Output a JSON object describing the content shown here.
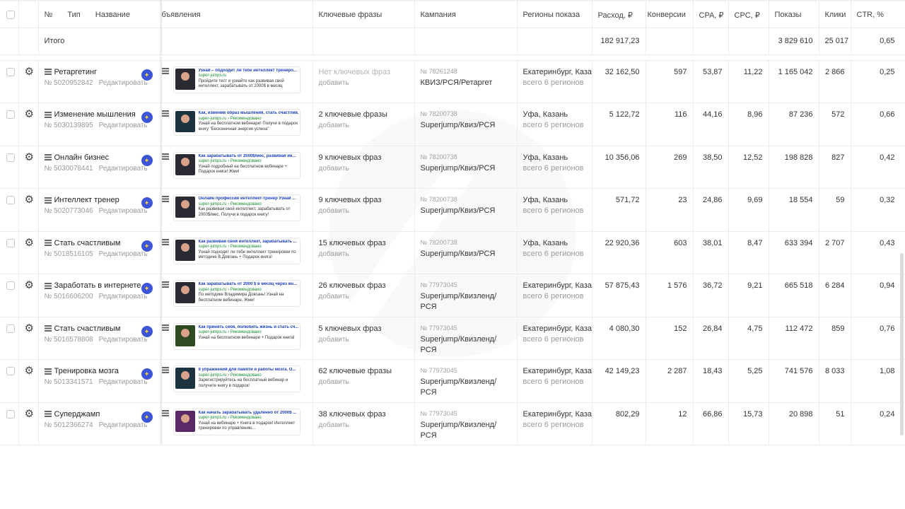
{
  "header": {
    "num": "№",
    "type": "Тип",
    "name": "Название",
    "ads": "бъявления",
    "keywords": "Ключевые фразы",
    "campaign": "Кампания",
    "regions": "Регионы показа",
    "spend": "Расход, ₽",
    "conversions": "Конверсии",
    "cpa": "CPA, ₽",
    "cpc": "CPC, ₽",
    "impressions": "Показы",
    "clicks": "Клики",
    "ctr": "CTR, %"
  },
  "total": {
    "label": "Итого",
    "spend": "182 917,23",
    "impressions": "3 829 610",
    "clicks": "25 017",
    "ctr": "0,65"
  },
  "icons": {
    "settings": "gear-icon",
    "badge": "autotargeting-badge-icon",
    "type": "list-type-icon"
  },
  "rows": [
    {
      "name": "Ретаргетинг",
      "id": "№ 5020952842",
      "edit": "Редактировать",
      "ad_title": "Узнай – подходит ли тебе интеллект трениро...",
      "ad_url": "super-jumps.ru",
      "ad_desc": "Пройдите тест и узнайте как развивая свой интеллект, зарабатывать от 2000$ в месяц",
      "kw": "Нет ключевых фраз",
      "kw_add": "добавить",
      "c_num": "№ 78261248",
      "c_name": "КВИЗ/РСЯ/Ретаргет",
      "region": "Екатеринбург, Каза",
      "region_sub": "всего 6 регионов",
      "spend": "32 162,50",
      "conv": "597",
      "cpa": "53,87",
      "cpc": "11,22",
      "impr": "1 165 042",
      "clicks": "2 866",
      "ctr": "0,25"
    },
    {
      "name": "Изменение мышления",
      "id": "№ 5030139895",
      "edit": "Редактировать",
      "ad_title": "Как, изменив образ мышления, стать счастлив...",
      "ad_url": "super-jumps.ru › Рекомендовано",
      "ad_desc": "Узнай на бесплатном вебинаре! Получи в подарок книгу \"Бесконечная энергия успеха\"",
      "kw": "2 ключевые фразы",
      "kw_add": "добавить",
      "c_num": "№ 78200738",
      "c_name": "Superjump/Квиз/РСЯ",
      "region": "Уфа, Казань",
      "region_sub": "всего 6 регионов",
      "spend": "5 122,72",
      "conv": "116",
      "cpa": "44,16",
      "cpc": "8,96",
      "impr": "87 236",
      "clicks": "572",
      "ctr": "0,66"
    },
    {
      "name": "Онлайн бизнес",
      "id": "№ 5030078441",
      "edit": "Редактировать",
      "ad_title": "Как зарабатывать от 2000$/мес, развивая ин...",
      "ad_url": "super-jumps.ru › Рекомендовано",
      "ad_desc": "Узнай подробный на бесплатном вебинаре + Подарок книга! Жми!",
      "kw": "9 ключевых фраз",
      "kw_add": "добавить",
      "c_num": "№ 78200738",
      "c_name": "Superjump/Квиз/РСЯ",
      "region": "Уфа, Казань",
      "region_sub": "всего 6 регионов",
      "spend": "10 356,06",
      "conv": "269",
      "cpa": "38,50",
      "cpc": "12,52",
      "impr": "198 828",
      "clicks": "827",
      "ctr": "0,42"
    },
    {
      "name": "Интеллект тренер",
      "id": "№ 5020773046",
      "edit": "Редактировать",
      "ad_title": "Онлайн профессия интеллект-тренер Узнай ...",
      "ad_url": "super-jumps.ru › Рекомендовано",
      "ad_desc": "Как развивая свой интеллект, зарабатывать от 2000$/мес. Получи в подарок книгу!",
      "kw": "9 ключевых фраз",
      "kw_add": "добавить",
      "c_num": "№ 78200738",
      "c_name": "Superjump/Квиз/РСЯ",
      "region": "Уфа, Казань",
      "region_sub": "всего 6 регионов",
      "spend": "571,72",
      "conv": "23",
      "cpa": "24,86",
      "cpc": "9,69",
      "impr": "18 554",
      "clicks": "59",
      "ctr": "0,32"
    },
    {
      "name": "Стать счастливым",
      "id": "№ 5018516105",
      "edit": "Редактировать",
      "ad_title": "Как развивая свой интеллект, зарабатывать ...",
      "ad_url": "super-jumps.ru › Рекомендовано",
      "ad_desc": "Узнай подходит ли тебе интеллект тренировки по методике В.Довгань + Подарок книга!",
      "kw": "15 ключевых фраз",
      "kw_add": "добавить",
      "c_num": "№ 78200738",
      "c_name": "Superjump/Квиз/РСЯ",
      "region": "Уфа, Казань",
      "region_sub": "всего 6 регионов",
      "spend": "22 920,36",
      "conv": "603",
      "cpa": "38,01",
      "cpc": "8,47",
      "impr": "633 394",
      "clicks": "2 707",
      "ctr": "0,43"
    },
    {
      "name": "Заработать в интернете",
      "id": "№ 5016606200",
      "edit": "Редактировать",
      "ad_title": "Как зарабатывать от 2000 $ в месяц через ин...",
      "ad_url": "super-jumps.ru › Рекомендовано",
      "ad_desc": "По методике Владимира Довгань! Узнай на бесплатном вебинаре, Жми!",
      "kw": "26 ключевых фраз",
      "kw_add": "добавить",
      "c_num": "№ 77973045",
      "c_name": "Superjump/Квизленд/РСЯ",
      "region": "Екатеринбург, Каза",
      "region_sub": "всего 6 регионов",
      "spend": "57 875,43",
      "conv": "1 576",
      "cpa": "36,72",
      "cpc": "9,21",
      "impr": "665 518",
      "clicks": "6 284",
      "ctr": "0,94"
    },
    {
      "name": "Стать счастливым",
      "id": "№ 5016578808",
      "edit": "Редактировать",
      "ad_title": "Как принять себя, полюбить жизнь и стать сч...",
      "ad_url": "super-jumps.ru › Рекомендовано",
      "ad_desc": "Узнай на бесплатном вебинаре + Подарок книга!",
      "kw": "5 ключевых фраз",
      "kw_add": "добавить",
      "c_num": "№ 77973045",
      "c_name": "Superjump/Квизленд/РСЯ",
      "region": "Екатеринбург, Каза",
      "region_sub": "всего 6 регионов",
      "spend": "4 080,30",
      "conv": "152",
      "cpa": "26,84",
      "cpc": "4,75",
      "impr": "112 472",
      "clicks": "859",
      "ctr": "0,76"
    },
    {
      "name": "Тренировка мозга",
      "id": "№ 5013341571",
      "edit": "Редактировать",
      "ad_title": "8 упражнений для памяти и работы мозга. О...",
      "ad_url": "super-jumps.ru › Рекомендовано",
      "ad_desc": "Зарегистрируйтесь на бесплатный вебинар и получите книгу в подарок!",
      "kw": "62 ключевые фразы",
      "kw_add": "добавить",
      "c_num": "№ 77973045",
      "c_name": "Superjump/Квизленд/РСЯ",
      "region": "Екатеринбург, Каза",
      "region_sub": "всего 6 регионов",
      "spend": "42 149,23",
      "conv": "2 287",
      "cpa": "18,43",
      "cpc": "5,25",
      "impr": "741 576",
      "clicks": "8 033",
      "ctr": "1,08"
    },
    {
      "name": "Суперджамп",
      "id": "№ 5012366274",
      "edit": "Редактировать",
      "ad_title": "Как начать зарабатывать удаленно от 2000$ ...",
      "ad_url": "super-jumps.ru › Рекомендовано",
      "ad_desc": "Узнай на вебинаре + Книга в подарок! Интеллект тренировки по управлению...",
      "kw": "38 ключевых фраз",
      "kw_add": "добавить",
      "c_num": "№ 77973045",
      "c_name": "Superjump/Квизленд/РСЯ",
      "region": "Екатеринбург, Каза",
      "region_sub": "всего 6 регионов",
      "spend": "802,29",
      "conv": "12",
      "cpa": "66,86",
      "cpc": "15,73",
      "impr": "20 898",
      "clicks": "51",
      "ctr": "0,24"
    }
  ]
}
